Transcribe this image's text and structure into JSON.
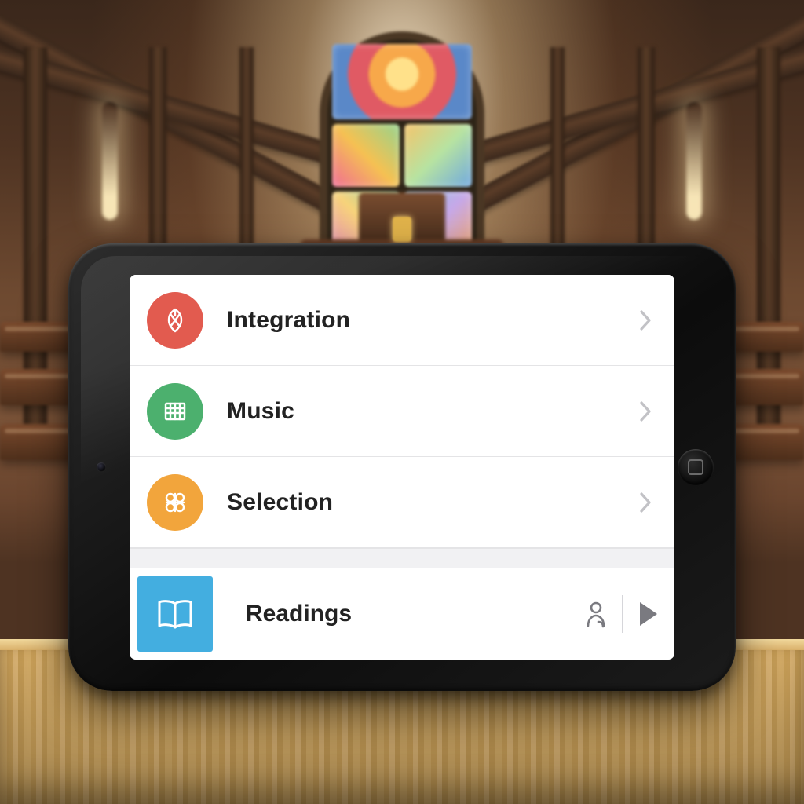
{
  "menu": {
    "items": [
      {
        "label": "Integration",
        "icon": "emblem-icon",
        "color": "red"
      },
      {
        "label": "Music",
        "icon": "score-icon",
        "color": "green"
      },
      {
        "label": "Selection",
        "icon": "tiles-icon",
        "color": "orange"
      }
    ]
  },
  "secondary": {
    "label": "Readings",
    "icon": "book-icon",
    "actions": {
      "profile_icon": "person-icon",
      "play_icon": "play-icon"
    }
  },
  "colors": {
    "red": "#e25b4f",
    "green": "#4cb06e",
    "orange": "#f2a53c",
    "blue": "#43aee0",
    "chevron": "#c2c2c6",
    "action_icon": "#7a7a80"
  }
}
